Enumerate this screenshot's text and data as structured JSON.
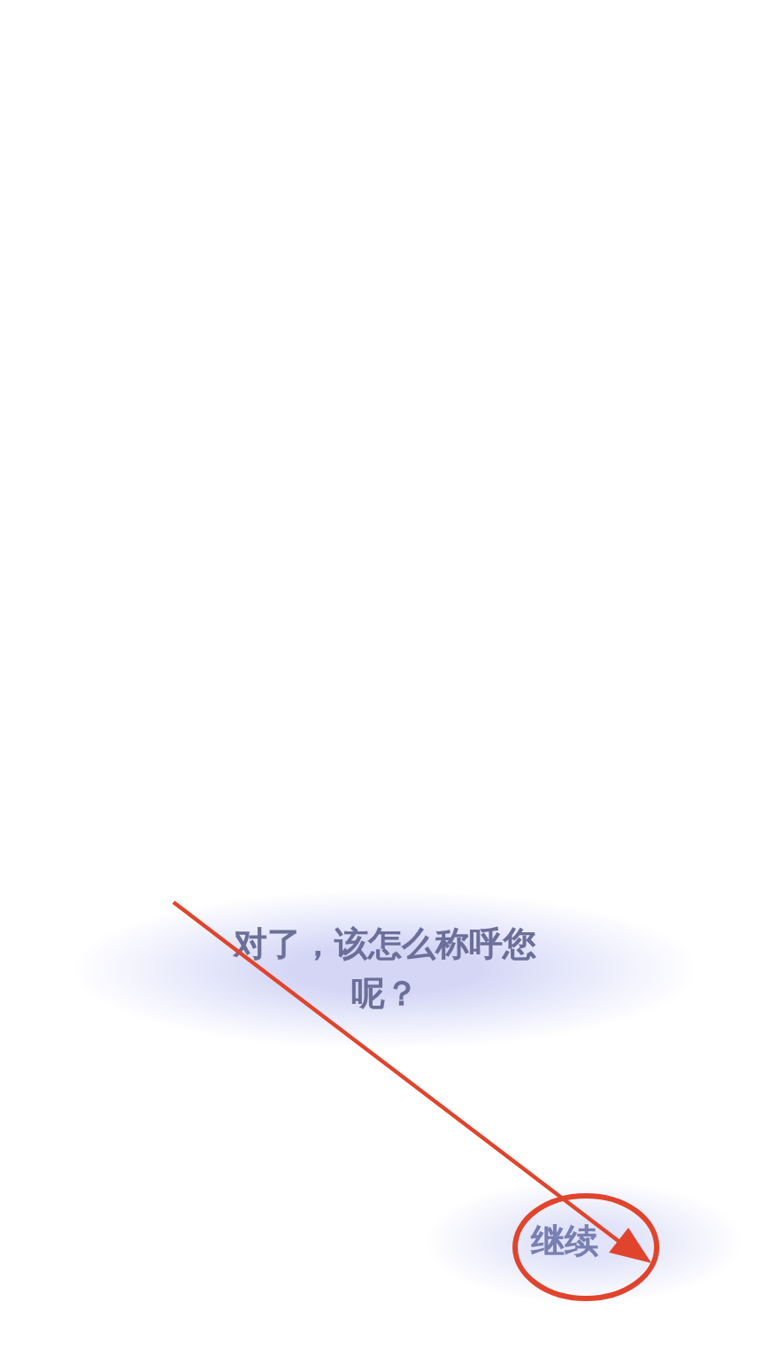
{
  "dialog": {
    "text": "对了，该怎么称呼您呢？"
  },
  "continue_button": {
    "label": "继续"
  },
  "annotation": {
    "kind": "arrow-circle",
    "color": "#e0442c"
  }
}
